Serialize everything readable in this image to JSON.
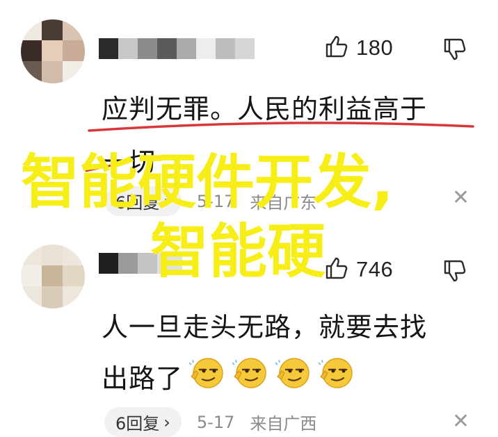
{
  "comments": [
    {
      "likes": "180",
      "text_line1": "应判无罪。人民的利益高于",
      "text_line2": "一切",
      "reply": "6回复",
      "date": "5-17",
      "location": "来自广东"
    },
    {
      "likes": "746",
      "text_line1": "人一旦走头无路，就要去找",
      "text_line2": "出路了",
      "reply": "6回复",
      "date": "5-17",
      "location": "来自广西"
    }
  ],
  "overlay": {
    "line1": "智能硬件开发,",
    "line2": "智能硬"
  },
  "icons": {
    "like": "thumbs-up-icon",
    "dislike": "thumbs-down-icon",
    "close": "close-icon",
    "emoji": "smug-emoji-icon"
  },
  "colors": {
    "overlay_text": "#f7ee17",
    "underline": "#d9383a",
    "meta_text": "#8a8a8a"
  }
}
